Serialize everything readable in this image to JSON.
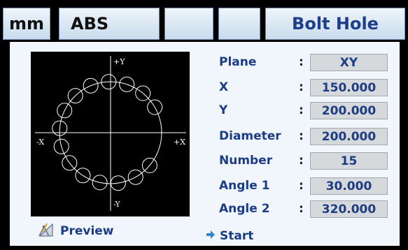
{
  "tabs": {
    "unit": "mm",
    "mode": "ABS",
    "title": "Bolt Hole"
  },
  "preview": {
    "axis_labels": {
      "plus_y": "+Y",
      "minus_y": "-Y",
      "plus_x": "+X",
      "minus_x": "-X"
    }
  },
  "fields": [
    {
      "label": "Plane",
      "value": "XY"
    },
    {
      "label": "X",
      "value": "150.000"
    },
    {
      "label": "Y",
      "value": "200.000"
    },
    {
      "label": "Diameter",
      "value": "200.000"
    },
    {
      "label": "Number",
      "value": "15"
    },
    {
      "label": "Angle 1",
      "value": "30.000"
    },
    {
      "label": "Angle 2",
      "value": "320.000"
    }
  ],
  "separator": ":",
  "actions": {
    "preview": "Preview",
    "start": "Start"
  },
  "colors": {
    "accent": "#1c3c86",
    "background": "#f1f6fc",
    "value_box": "#d6d9dc"
  },
  "icons": {
    "preview": "compass-ruler-icon",
    "start": "arrow-right-icon"
  }
}
